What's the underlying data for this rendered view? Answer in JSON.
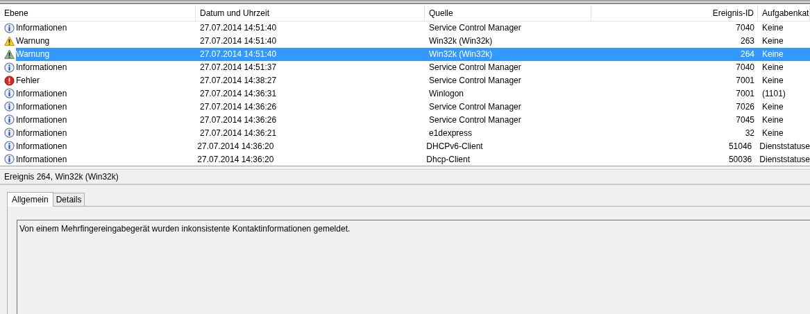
{
  "table": {
    "columns": [
      "Ebene",
      "Datum und Uhrzeit",
      "Quelle",
      "Ereignis-ID",
      "Aufgabenkat"
    ],
    "rows": [
      {
        "kind": "info",
        "level": "Informationen",
        "date": "27.07.2014 14:51:40",
        "source": "Service Control Manager",
        "id": "7040",
        "task": "Keine",
        "selected": false
      },
      {
        "kind": "warning",
        "level": "Warnung",
        "date": "27.07.2014 14:51:40",
        "source": "Win32k (Win32k)",
        "id": "263",
        "task": "Keine",
        "selected": false
      },
      {
        "kind": "warning",
        "level": "Warnung",
        "date": "27.07.2014 14:51:40",
        "source": "Win32k (Win32k)",
        "id": "264",
        "task": "Keine",
        "selected": true
      },
      {
        "kind": "info",
        "level": "Informationen",
        "date": "27.07.2014 14:51:37",
        "source": "Service Control Manager",
        "id": "7040",
        "task": "Keine",
        "selected": false
      },
      {
        "kind": "error",
        "level": "Fehler",
        "date": "27.07.2014 14:38:27",
        "source": "Service Control Manager",
        "id": "7001",
        "task": "Keine",
        "selected": false
      },
      {
        "kind": "info",
        "level": "Informationen",
        "date": "27.07.2014 14:36:31",
        "source": "Winlogon",
        "id": "7001",
        "task": "(1101)",
        "selected": false
      },
      {
        "kind": "info",
        "level": "Informationen",
        "date": "27.07.2014 14:36:26",
        "source": "Service Control Manager",
        "id": "7026",
        "task": "Keine",
        "selected": false
      },
      {
        "kind": "info",
        "level": "Informationen",
        "date": "27.07.2014 14:36:26",
        "source": "Service Control Manager",
        "id": "7045",
        "task": "Keine",
        "selected": false
      },
      {
        "kind": "info",
        "level": "Informationen",
        "date": "27.07.2014 14:36:21",
        "source": "e1dexpress",
        "id": "32",
        "task": "Keine",
        "selected": false
      },
      {
        "kind": "info",
        "level": "Informationen",
        "date": "27.07.2014 14:36:20",
        "source": "DHCPv6-Client",
        "id": "51046",
        "task": "Dienststatuse",
        "selected": false
      },
      {
        "kind": "info",
        "level": "Informationen",
        "date": "27.07.2014 14:36:20",
        "source": "Dhcp-Client",
        "id": "50036",
        "task": "Dienststatuse",
        "selected": false
      }
    ]
  },
  "details": {
    "title": "Ereignis 264, Win32k (Win32k)",
    "tabs": [
      {
        "label": "Allgemein",
        "selected": true
      },
      {
        "label": "Details",
        "selected": false
      }
    ],
    "message": "Von einem Mehrfingereingabegerät wurden inkonsistente Kontaktinformationen gemeldet."
  }
}
